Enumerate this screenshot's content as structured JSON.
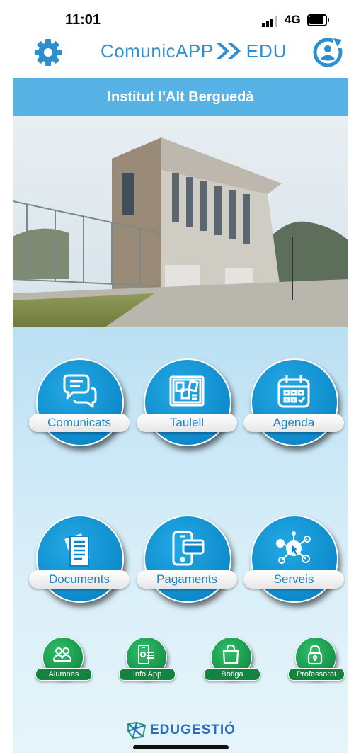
{
  "status_bar": {
    "time": "11:01",
    "network": "4G"
  },
  "header": {
    "logo_main": "ComunicAPP",
    "logo_suffix": "EDU"
  },
  "school": {
    "name": "Institut l'Alt Berguedà"
  },
  "main_buttons": [
    {
      "label": "Comunicats",
      "icon": "speech-bubbles-icon"
    },
    {
      "label": "Taulell",
      "icon": "notice-board-icon"
    },
    {
      "label": "Agenda",
      "icon": "calendar-icon"
    },
    {
      "label": "Documents",
      "icon": "documents-icon"
    },
    {
      "label": "Pagaments",
      "icon": "phone-card-payment-icon"
    },
    {
      "label": "Serveis",
      "icon": "network-services-icon"
    }
  ],
  "small_buttons": [
    {
      "label": "Alumnes",
      "icon": "students-icon"
    },
    {
      "label": "Info App",
      "icon": "info-app-icon"
    },
    {
      "label": "Botiga",
      "icon": "shopping-bag-icon"
    },
    {
      "label": "Professorat",
      "icon": "padlock-icon"
    }
  ],
  "footer": {
    "brand": "EDUGESTIÓ"
  },
  "colors": {
    "accent_blue": "#0b86c8",
    "banner_blue": "#57b2e5",
    "green": "#128c45"
  }
}
